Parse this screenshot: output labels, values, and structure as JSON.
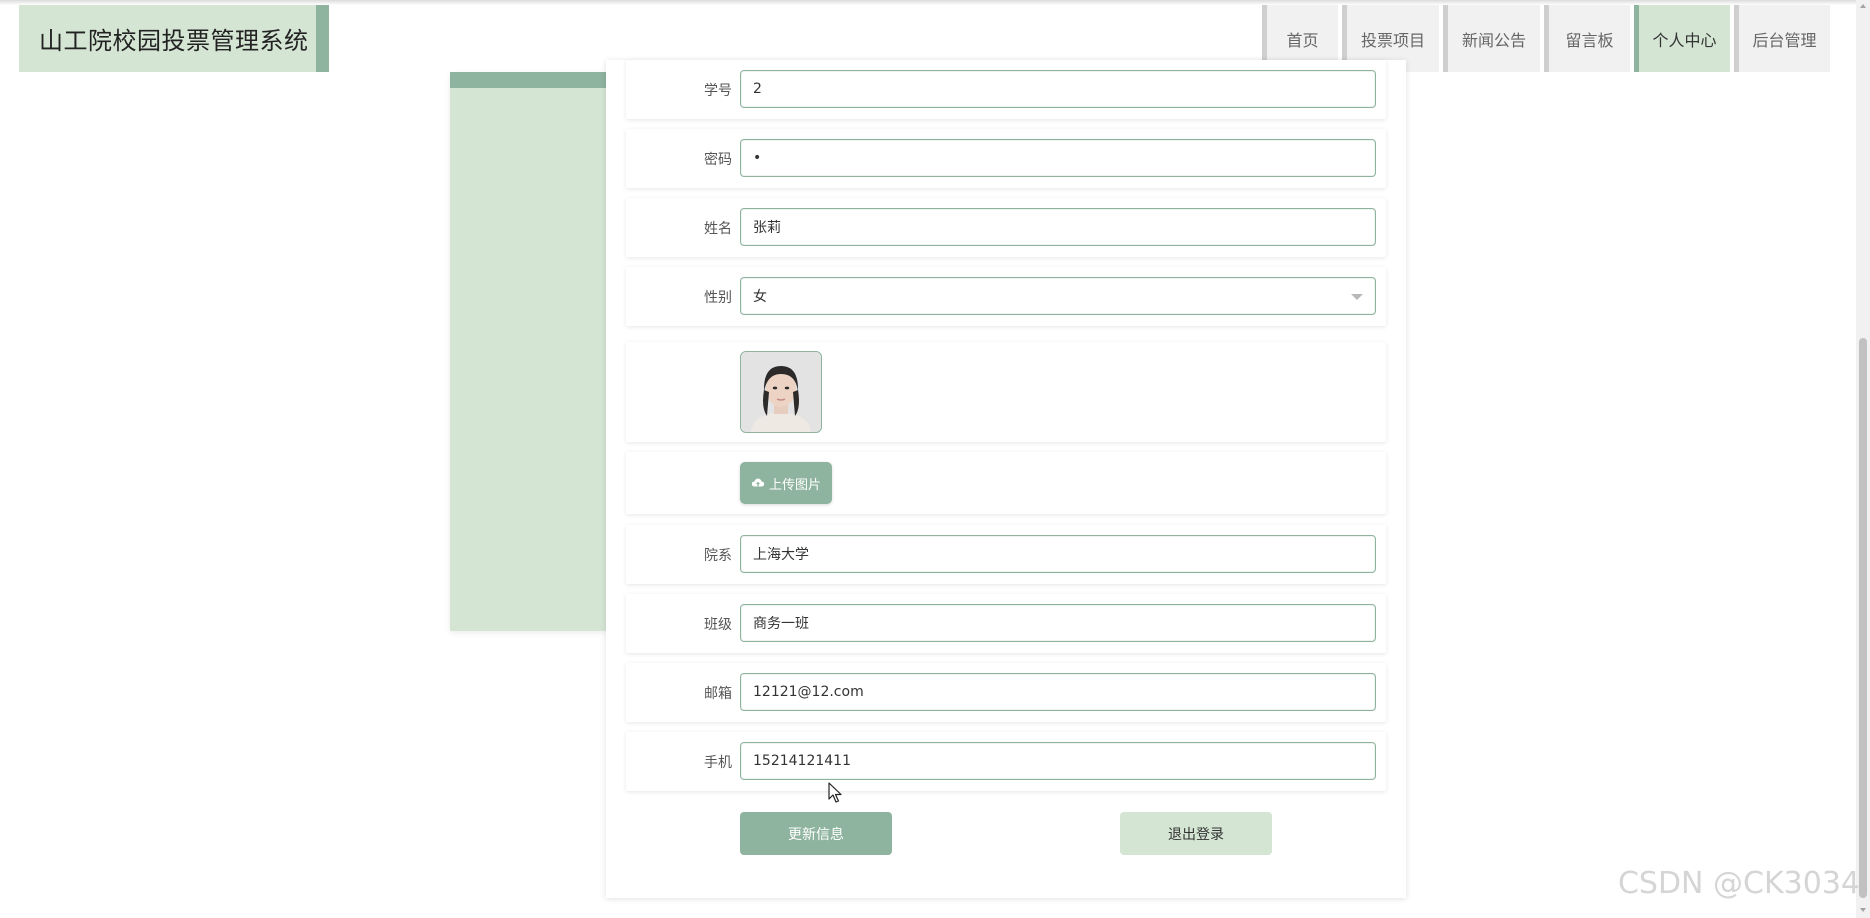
{
  "header": {
    "title": "山工院校园投票管理系统",
    "nav": [
      {
        "label": "首页",
        "active": false
      },
      {
        "label": "投票项目",
        "active": false
      },
      {
        "label": "新闻公告",
        "active": false
      },
      {
        "label": "留言板",
        "active": false
      },
      {
        "label": "个人中心",
        "active": true
      },
      {
        "label": "后台管理",
        "active": false
      }
    ]
  },
  "form": {
    "student_id_label": "学号",
    "student_id_value": "2",
    "password_label": "密码",
    "password_value": "•",
    "name_label": "姓名",
    "name_value": "张莉",
    "gender_label": "性别",
    "gender_value": "女",
    "upload_label": "上传图片",
    "department_label": "院系",
    "department_value": "上海大学",
    "class_label": "班级",
    "class_value": "商务一班",
    "email_label": "邮箱",
    "email_value": "12121@12.com",
    "phone_label": "手机",
    "phone_value": "15214121411"
  },
  "actions": {
    "update_label": "更新信息",
    "logout_label": "退出登录"
  },
  "watermark": "CSDN @CK3034",
  "colors": {
    "accent_green": "#8eb39e",
    "light_green": "#d4e5d4",
    "nav_inactive_bg": "#f1f1f1"
  }
}
